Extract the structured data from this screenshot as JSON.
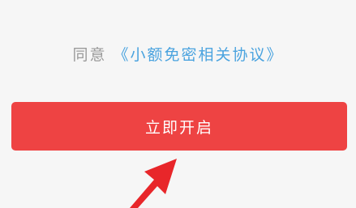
{
  "agreement": {
    "prefix": "同意",
    "link_text": "《小额免密相关协议》"
  },
  "action_button": {
    "label": "立即开启"
  },
  "colors": {
    "background": "#f6f6f6",
    "button": "#ee4343",
    "link": "#4aa3df",
    "prefix_text": "#9a9a9a",
    "arrow": "#e8262a"
  },
  "annotation": {
    "icon": "red-arrow-pointer"
  }
}
